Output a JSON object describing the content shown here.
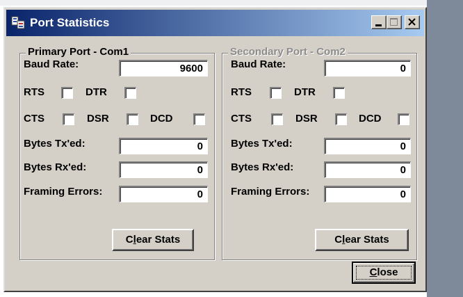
{
  "window": {
    "title": "Port Statistics",
    "title_icon": "port-stats-icon",
    "controls": [
      "minimize-icon",
      "maximize-icon",
      "close-icon"
    ]
  },
  "primary": {
    "group_label": "Primary Port - Com1",
    "baud_label": "Baud Rate:",
    "baud_value": "9600",
    "rts": "RTS",
    "dtr": "DTR",
    "cts": "CTS",
    "dsr": "DSR",
    "dcd": "DCD",
    "tx_label": "Bytes Tx'ed:",
    "tx_value": "0",
    "rx_label": "Bytes Rx'ed:",
    "rx_value": "0",
    "framing_label": "Framing Errors:",
    "framing_value": "0",
    "clear_pre": "C",
    "clear_acc": "l",
    "clear_post": "ear Stats"
  },
  "secondary": {
    "group_label": "Secondary Port - Com2",
    "baud_label": "Baud Rate:",
    "baud_value": "0",
    "rts": "RTS",
    "dtr": "DTR",
    "cts": "CTS",
    "dsr": "DSR",
    "dcd": "DCD",
    "tx_label": "Bytes Tx'ed:",
    "tx_value": "0",
    "rx_label": "Bytes Rx'ed:",
    "rx_value": "0",
    "framing_label": "Framing Errors:",
    "framing_value": "0",
    "clear_pre": "C",
    "clear_acc": "l",
    "clear_post": "ear Stats"
  },
  "footer": {
    "close_acc": "C",
    "close_post": "lose"
  },
  "colors": {
    "dialog_bg": "#d4d0c8",
    "titlebar_start": "#0a246a",
    "titlebar_end": "#a6caf0",
    "disabled_text": "#8c8c8c"
  }
}
